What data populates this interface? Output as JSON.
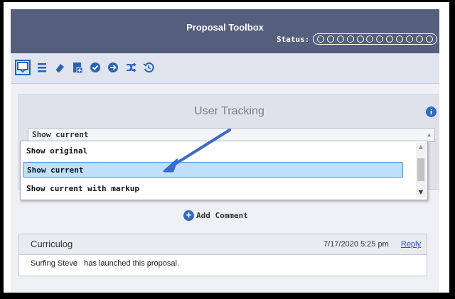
{
  "toolbox": {
    "title": "Proposal Toolbox",
    "status_label": "Status:",
    "status_steps": 12
  },
  "toolbar": {
    "icons": [
      "comment-icon",
      "list-icon",
      "eraser-icon",
      "add-file-icon",
      "check-icon",
      "forward-icon",
      "shuffle-icon",
      "history-icon"
    ],
    "selected": "comment-icon"
  },
  "tracking": {
    "title": "User Tracking",
    "selected_value": "Show current",
    "options": [
      "Show original",
      "Show current",
      "Show current with markup"
    ],
    "highlighted_index": 1
  },
  "comments": {
    "add_label": "Add Comment",
    "items": [
      {
        "author": "Curriculog",
        "date": "7/17/2020 5:25 pm",
        "reply_label": "Reply",
        "user": "Surfing Steve",
        "text": "has launched this proposal."
      }
    ]
  },
  "colors": {
    "header": "#555e7c",
    "accent": "#2f6bc1",
    "arrow": "#3d6ac7"
  }
}
